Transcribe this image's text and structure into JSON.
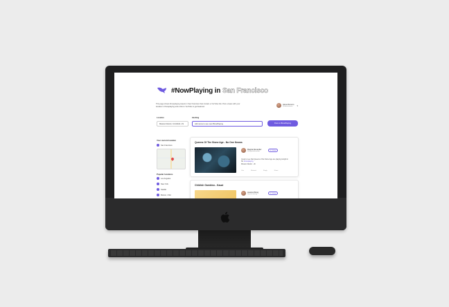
{
  "app": {
    "title_prefix": "#NowPlaying in",
    "title_city": "San Francisco",
    "intro_text": "This page shows #nowplaying tweets in San Francisco that contain a YouTube link. Post a tweet with your location in #nowplaying and a link to YouTube to get featured.",
    "current_user": {
      "name": "Alexa Romero",
      "handle": "@alexaromero"
    }
  },
  "search": {
    "location_label": "Location",
    "location_value": "Mission District, CA 94110, US",
    "hashtag_label": "Hashtag",
    "hashtag_value": "Add name to see new #NowPlaying",
    "cta_label": "Post to #NowPlaying"
  },
  "sidebar": {
    "current_location_title": "Your current location",
    "current_location": "San Francisco",
    "popular_title": "Popular locations",
    "popular": [
      "Los Angeles",
      "New York",
      "Seattle",
      "Boston, USA"
    ]
  },
  "feed": [
    {
      "title": "Queens Of The Stone Age - No One Knows",
      "user_name": "Regina Alexander",
      "user_handle": "@reginaalexander",
      "follow_label": "Follow",
      "text": "Great to see that Queens of the Stone Age are playing tonight in SF.",
      "tag": "#nowplaying",
      "meta": "Mission District · 2h",
      "actions": [
        "Like",
        "Retweet",
        "Reply",
        "Share"
      ]
    },
    {
      "title": "Childish Gambino - Kauai",
      "user_name": "Jessica Wong",
      "user_handle": "@jessicawong",
      "follow_label": "Follow"
    }
  ],
  "colors": {
    "accent": "#6f5be0"
  }
}
